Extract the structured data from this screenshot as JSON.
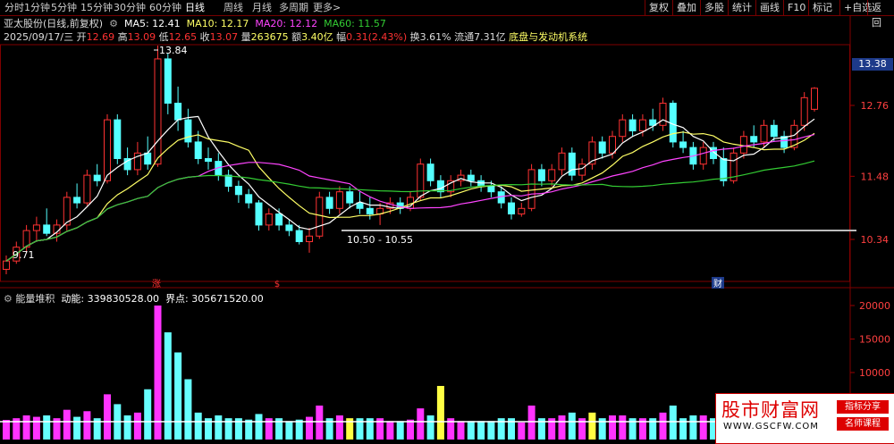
{
  "toolbar": {
    "periods": [
      "分时",
      "1分钟",
      "5分钟",
      "15分钟",
      "30分钟",
      "60分钟",
      "日线",
      "周线",
      "月线",
      "多周期",
      "更多>"
    ],
    "active_period": "日线",
    "right_tools": [
      "复权",
      "叠加",
      "多股",
      "统计",
      "画线",
      "F10",
      "标记",
      "+自选",
      "返回"
    ]
  },
  "stock": {
    "title": "亚太股份(日线,前复权)",
    "ma5": "MA5: 12.41",
    "ma10": "MA10: 12.17",
    "ma20": "MA20: 12.12",
    "ma60": "MA60: 11.57",
    "date": "2025/09/17/三",
    "open_label": "开",
    "open": "12.69",
    "high_label": "高",
    "high": "13.09",
    "low_label": "低",
    "low": "12.65",
    "close_label": "收",
    "close": "13.07",
    "volume_label": "量",
    "volume": "263675",
    "amount_label": "额",
    "amount": "3.40亿",
    "change_label": "幅",
    "change": "0.31(2.43%)",
    "turnover_label": "换",
    "turnover": "3.61%",
    "float_label": "流通",
    "float": "7.31亿",
    "concept": "底盘与发动机系统"
  },
  "colors": {
    "up": "#ff3232",
    "down": "#54ffff",
    "ma5": "#ffffff",
    "ma10": "#ffff66",
    "ma20": "#ff44ff",
    "ma60": "#33cc33"
  },
  "price_axis": {
    "current": "13.38",
    "ticks": [
      "12.76",
      "11.48",
      "10.34"
    ]
  },
  "annotations": {
    "high_label": "13.84",
    "low_label": "9.71",
    "range_label": "10.50 - 10.55",
    "markers": [
      "涨",
      "$",
      "财"
    ]
  },
  "indicator": {
    "name": "能量堆积",
    "energy": "动能: 339830528.00",
    "boundary": "界点: 305671520.00",
    "ticks": [
      "20000",
      "15000",
      "10000"
    ]
  },
  "watermark": {
    "text": "股市财富网",
    "url": "WWW.GSCFW.COM",
    "tag1": "指标分享",
    "tag2": "名师课程"
  },
  "chart_data": {
    "type": "candlestick",
    "price_axis_ticks": [
      12.76,
      11.48,
      10.34
    ],
    "ohlc": [
      [
        9.8,
        10.05,
        9.71,
        9.95
      ],
      [
        9.95,
        10.3,
        9.9,
        10.2
      ],
      [
        10.2,
        10.6,
        10.1,
        10.5
      ],
      [
        10.5,
        10.75,
        10.3,
        10.6
      ],
      [
        10.6,
        10.9,
        10.4,
        10.45
      ],
      [
        10.45,
        10.7,
        10.3,
        10.6
      ],
      [
        10.6,
        11.2,
        10.5,
        11.1
      ],
      [
        11.1,
        11.35,
        10.9,
        11.0
      ],
      [
        11.0,
        11.6,
        10.95,
        11.5
      ],
      [
        11.5,
        11.7,
        11.3,
        11.4
      ],
      [
        11.4,
        12.6,
        11.35,
        12.5
      ],
      [
        12.5,
        12.6,
        11.7,
        11.8
      ],
      [
        11.8,
        12.0,
        11.5,
        11.6
      ],
      [
        11.6,
        12.1,
        11.5,
        11.9
      ],
      [
        11.9,
        12.2,
        11.6,
        11.7
      ],
      [
        11.7,
        13.84,
        11.65,
        13.6
      ],
      [
        13.6,
        13.7,
        12.6,
        12.8
      ],
      [
        12.8,
        13.1,
        12.3,
        12.5
      ],
      [
        12.5,
        12.7,
        12.0,
        12.1
      ],
      [
        12.1,
        12.3,
        11.7,
        11.8
      ],
      [
        11.8,
        12.0,
        11.6,
        11.75
      ],
      [
        11.75,
        11.9,
        11.4,
        11.5
      ],
      [
        11.5,
        11.6,
        11.2,
        11.3
      ],
      [
        11.3,
        11.4,
        11.0,
        11.15
      ],
      [
        11.15,
        11.25,
        10.9,
        11.0
      ],
      [
        11.0,
        11.05,
        10.5,
        10.6
      ],
      [
        10.6,
        10.9,
        10.5,
        10.8
      ],
      [
        10.8,
        10.9,
        10.5,
        10.6
      ],
      [
        10.6,
        10.7,
        10.4,
        10.5
      ],
      [
        10.5,
        10.6,
        10.25,
        10.3
      ],
      [
        10.3,
        10.55,
        10.1,
        10.4
      ],
      [
        10.4,
        11.2,
        10.35,
        11.1
      ],
      [
        11.1,
        11.2,
        10.8,
        10.9
      ],
      [
        10.9,
        11.3,
        10.8,
        11.2
      ],
      [
        11.2,
        11.3,
        10.9,
        11.0
      ],
      [
        11.0,
        11.2,
        10.8,
        10.9
      ],
      [
        10.9,
        11.1,
        10.7,
        10.8
      ],
      [
        10.8,
        11.0,
        10.6,
        10.9
      ],
      [
        10.9,
        11.1,
        10.8,
        11.0
      ],
      [
        11.0,
        11.1,
        10.8,
        10.9
      ],
      [
        10.9,
        11.2,
        10.85,
        11.1
      ],
      [
        11.1,
        11.8,
        11.05,
        11.7
      ],
      [
        11.7,
        11.8,
        11.3,
        11.4
      ],
      [
        11.4,
        11.5,
        11.1,
        11.2
      ],
      [
        11.2,
        11.5,
        11.1,
        11.4
      ],
      [
        11.4,
        11.6,
        11.3,
        11.5
      ],
      [
        11.5,
        11.6,
        11.3,
        11.4
      ],
      [
        11.4,
        11.5,
        11.2,
        11.3
      ],
      [
        11.3,
        11.4,
        11.1,
        11.2
      ],
      [
        11.2,
        11.3,
        10.9,
        11.0
      ],
      [
        11.0,
        11.1,
        10.7,
        10.8
      ],
      [
        10.8,
        11.0,
        10.75,
        10.9
      ],
      [
        10.9,
        11.7,
        10.85,
        11.6
      ],
      [
        11.6,
        11.7,
        11.3,
        11.4
      ],
      [
        11.4,
        11.7,
        11.3,
        11.6
      ],
      [
        11.6,
        12.0,
        11.5,
        11.9
      ],
      [
        11.9,
        12.0,
        11.4,
        11.5
      ],
      [
        11.5,
        11.8,
        11.4,
        11.7
      ],
      [
        11.7,
        12.2,
        11.6,
        12.1
      ],
      [
        12.1,
        12.2,
        11.8,
        11.9
      ],
      [
        11.9,
        12.3,
        11.8,
        12.2
      ],
      [
        12.2,
        12.6,
        12.1,
        12.5
      ],
      [
        12.5,
        12.6,
        12.2,
        12.3
      ],
      [
        12.3,
        12.6,
        12.2,
        12.5
      ],
      [
        12.5,
        12.7,
        12.3,
        12.4
      ],
      [
        12.4,
        12.9,
        12.3,
        12.8
      ],
      [
        12.8,
        12.85,
        12.0,
        12.1
      ],
      [
        12.1,
        12.3,
        11.9,
        12.0
      ],
      [
        12.0,
        12.1,
        11.6,
        11.7
      ],
      [
        11.7,
        12.1,
        11.6,
        12.0
      ],
      [
        12.0,
        12.1,
        11.7,
        11.8
      ],
      [
        11.8,
        12.0,
        11.3,
        11.4
      ],
      [
        11.4,
        12.0,
        11.35,
        11.9
      ],
      [
        11.9,
        12.3,
        11.8,
        12.2
      ],
      [
        12.2,
        12.4,
        12.0,
        12.1
      ],
      [
        12.1,
        12.5,
        12.0,
        12.4
      ],
      [
        12.4,
        12.5,
        12.1,
        12.2
      ],
      [
        12.2,
        12.3,
        11.9,
        12.0
      ],
      [
        12.0,
        12.5,
        11.95,
        12.4
      ],
      [
        12.4,
        13.0,
        12.3,
        12.9
      ],
      [
        12.69,
        13.09,
        12.65,
        13.07
      ]
    ]
  }
}
